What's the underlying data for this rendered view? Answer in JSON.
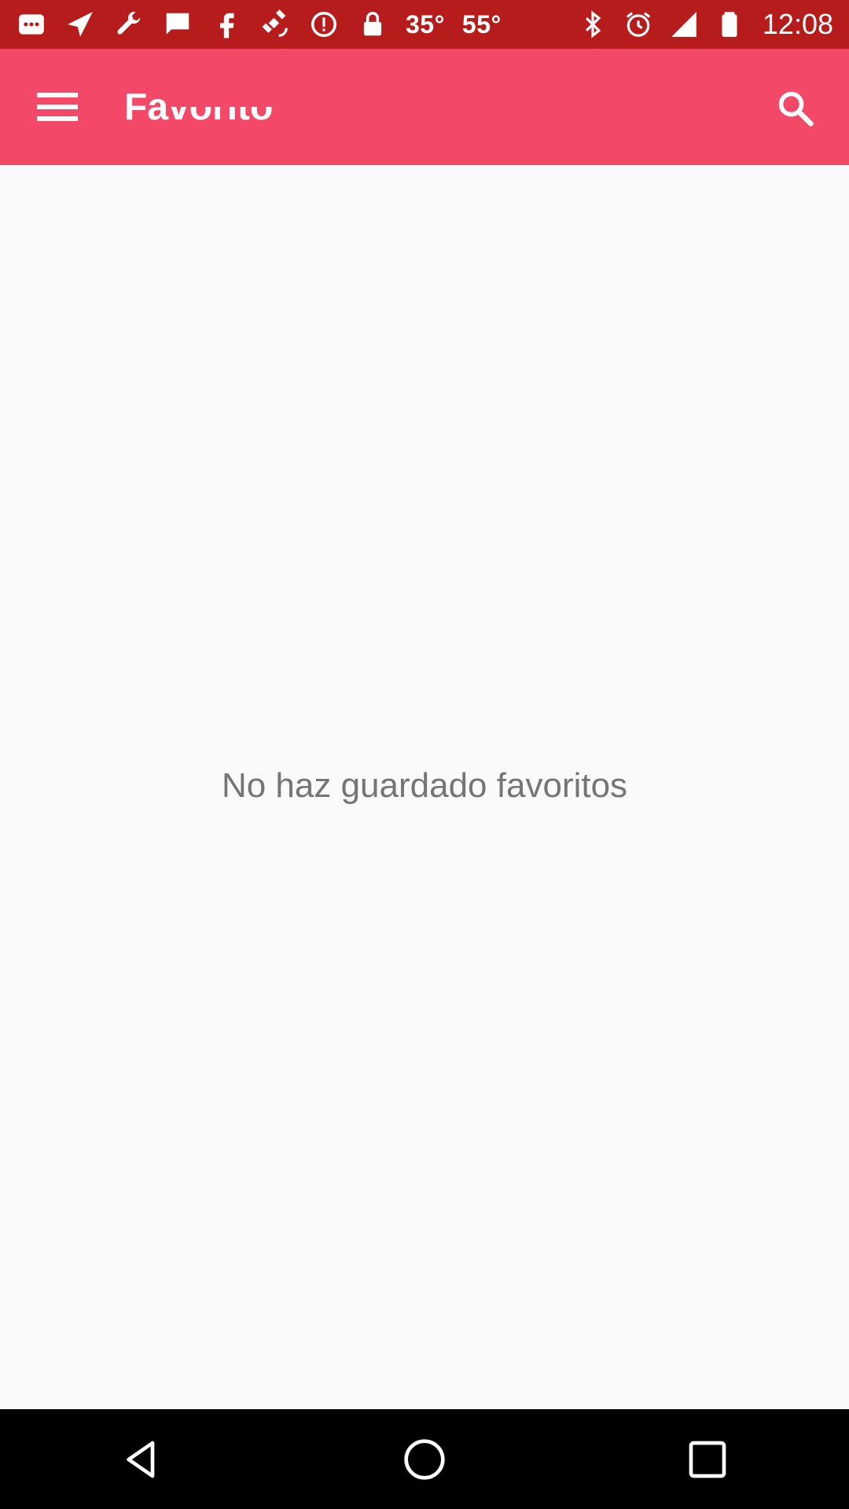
{
  "status_bar": {
    "temperature_1": "35°",
    "temperature_2": "55°",
    "time": "12:08",
    "icons_left": [
      "messaging-icon",
      "send-icon",
      "wrench-icon",
      "chat-icon",
      "facebook-icon",
      "fake-gps-satellite-icon",
      "alert-icon",
      "lock-icon"
    ],
    "icons_right": [
      "bluetooth-icon",
      "alarm-icon",
      "signal-icon",
      "battery-icon"
    ],
    "background": "#b71c1c"
  },
  "toolbar": {
    "title": "Favorito",
    "background": "#f44868",
    "menu_icon": "hamburger-menu-icon",
    "search_icon": "search-icon"
  },
  "main": {
    "empty_message": "No haz guardado favoritos"
  },
  "nav_bar": {
    "back_icon": "back-triangle-icon",
    "home_icon": "home-circle-icon",
    "recents_icon": "recents-square-icon"
  }
}
